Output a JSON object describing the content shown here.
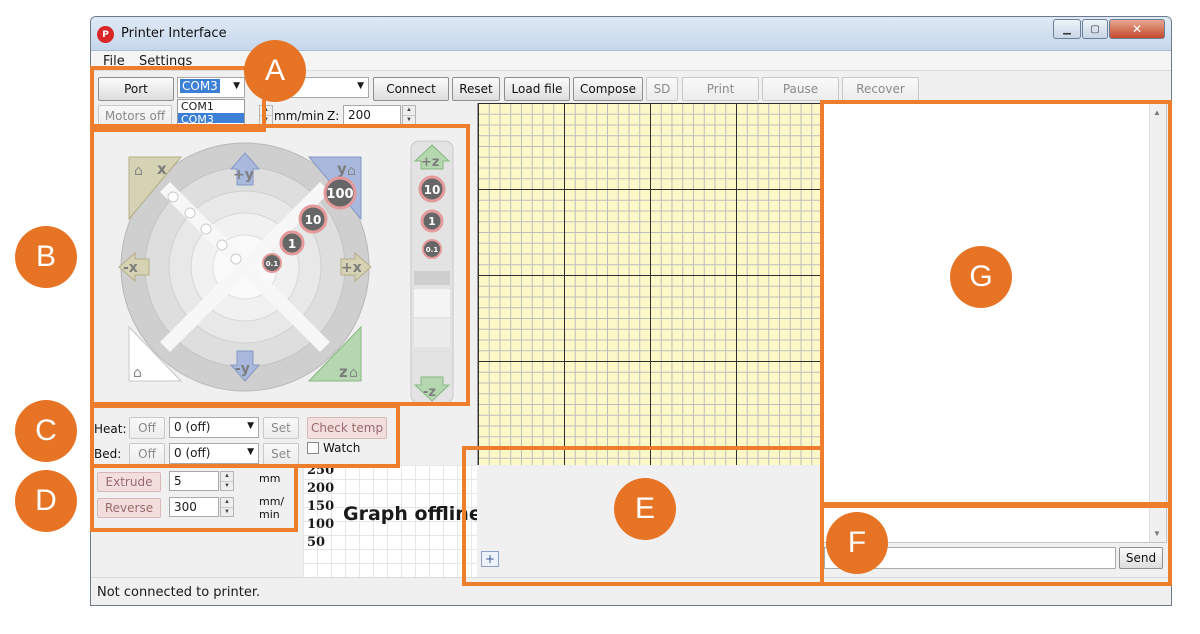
{
  "window": {
    "title": "Printer Interface",
    "icon_text": "P"
  },
  "menu": {
    "file": "File",
    "settings": "Settings"
  },
  "toolbar": {
    "port_label": "Port",
    "port_value": "COM3",
    "port_options": [
      "COM1",
      "COM3"
    ],
    "connect_label": "Connect",
    "reset_label": "Reset",
    "load_file_label": "Load file",
    "compose_label": "Compose",
    "sd_label": "SD",
    "print_label": "Print",
    "pause_label": "Pause",
    "recover_label": "Recover",
    "motors_off_label": "Motors off",
    "mm_min_label": "mm/min",
    "z_label": "Z:",
    "z_value": "200"
  },
  "jog": {
    "home_x": "x",
    "home_y": "y",
    "home_z": "z",
    "plus_y": "+y",
    "minus_y": "-y",
    "plus_x": "+x",
    "minus_x": "-x",
    "plus_z": "+z",
    "minus_z": "-z",
    "step_100": "100",
    "step_10": "10",
    "step_1": "1",
    "step_01": "0.1"
  },
  "temperature": {
    "heat_label": "Heat:",
    "bed_label": "Bed:",
    "off_label": "Off",
    "heat_value": "0 (off)",
    "bed_value": "0 (off)",
    "set_label": "Set",
    "check_temp_label": "Check temp",
    "watch_label": "Watch"
  },
  "extrude": {
    "extrude_label": "Extrude",
    "reverse_label": "Reverse",
    "length_value": "5",
    "speed_value": "300",
    "mm_label": "mm",
    "mm_min_label": "mm/\nmin"
  },
  "graph": {
    "ticks": [
      "250",
      "200",
      "150",
      "100",
      "50"
    ],
    "offline_text": "Graph offline"
  },
  "console": {
    "send_label": "Send",
    "add_label": "+"
  },
  "status": {
    "text": "Not connected to printer."
  },
  "callouts": {
    "a": "A",
    "b": "B",
    "c": "C",
    "d": "D",
    "e": "E",
    "f": "F",
    "g": "G"
  },
  "colors": {
    "accent": "#ee7d2e",
    "plate": "#fdf8c8",
    "arrow_blue": "#a9b9dd",
    "arrow_green": "#b4d7b0",
    "arrow_tan": "#d6d2b4"
  }
}
